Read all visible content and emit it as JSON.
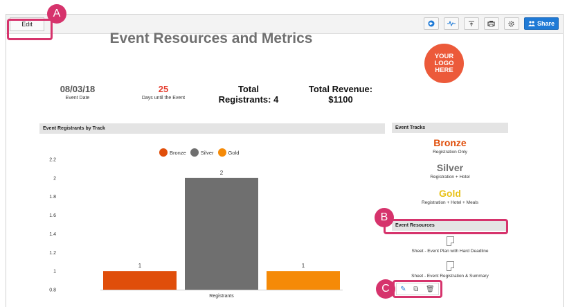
{
  "toolbar": {
    "edit_label": "Edit",
    "icons": [
      "globe-icon",
      "pulse-icon",
      "export-icon",
      "print-icon",
      "settings-icon"
    ],
    "share_label": "Share"
  },
  "dashboard": {
    "title": "Event Resources and Metrics",
    "metrics": [
      {
        "value": "08/03/18",
        "label": "Event Date",
        "color": "#555555"
      },
      {
        "value": "25",
        "label": "Days until the Event",
        "color": "#e53b2c"
      },
      {
        "value_line1": "Total",
        "value_line2": "Registrants: 4"
      },
      {
        "value_line1": "Total Revenue:",
        "value_line2": "$1100"
      }
    ],
    "logo": {
      "line1": "YOUR",
      "line2": "LOGO",
      "line3": "HERE",
      "color": "#ec5a3a"
    }
  },
  "chart_panel": {
    "title": "Event Registrants by Track"
  },
  "chart_data": {
    "type": "bar",
    "categories": [
      "Registrants"
    ],
    "series": [
      {
        "name": "Bronze",
        "values": [
          1
        ],
        "color": "#e04e0a"
      },
      {
        "name": "Silver",
        "values": [
          2
        ],
        "color": "#6f6f6f"
      },
      {
        "name": "Gold",
        "values": [
          1
        ],
        "color": "#f58a07"
      }
    ],
    "ylim": [
      0.8,
      2.2
    ],
    "yticks": [
      "0.8",
      "1",
      "1.2",
      "1.4",
      "1.6",
      "1.8",
      "2",
      "2.2"
    ],
    "legend": "top-center",
    "data_labels": [
      "1",
      "2",
      "1"
    ],
    "xlabel": "Registrants"
  },
  "tracks_panel": {
    "title": "Event Tracks",
    "tracks": [
      {
        "name": "Bronze",
        "desc": "Registration Only",
        "color": "#e04e0a"
      },
      {
        "name": "Silver",
        "desc": "Registration + Hotel",
        "color": "#6f6f6f"
      },
      {
        "name": "Gold",
        "desc": "Registration + Hotel + Meals",
        "color": "#e8c21a"
      }
    ]
  },
  "resources_panel": {
    "title": "Event Resources",
    "items": [
      {
        "label": "Sheet - Event Plan with Hard Deadline"
      },
      {
        "label": "Sheet - Event Registration & Summary"
      }
    ]
  },
  "callouts": {
    "a": "A",
    "b": "B",
    "c": "C",
    "color": "#d6336c"
  }
}
